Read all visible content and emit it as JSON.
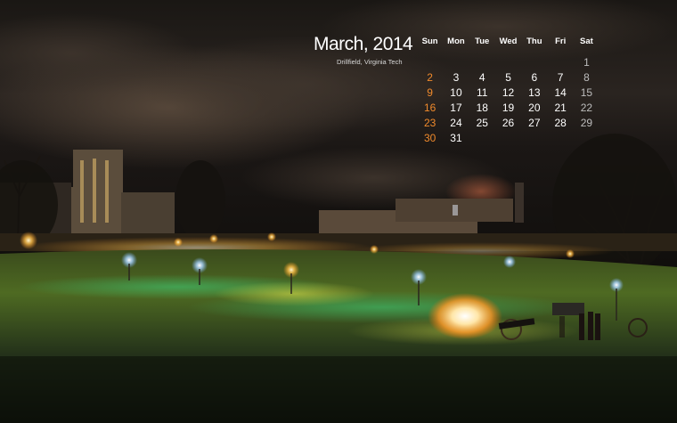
{
  "calendar": {
    "month_title": "March, 2014",
    "location": "Drillfield, Virginia Tech",
    "weekdays": [
      "Sun",
      "Mon",
      "Tue",
      "Wed",
      "Thu",
      "Fri",
      "Sat"
    ],
    "weeks": [
      [
        "",
        "",
        "",
        "",
        "",
        "",
        "1"
      ],
      [
        "2",
        "3",
        "4",
        "5",
        "6",
        "7",
        "8"
      ],
      [
        "9",
        "10",
        "11",
        "12",
        "13",
        "14",
        "15"
      ],
      [
        "16",
        "17",
        "18",
        "19",
        "20",
        "21",
        "22"
      ],
      [
        "23",
        "24",
        "25",
        "26",
        "27",
        "28",
        "29"
      ],
      [
        "30",
        "31",
        "",
        "",
        "",
        "",
        ""
      ]
    ]
  },
  "colors": {
    "sunday": "#f08a2c",
    "saturday": "#bdbdbd",
    "weekday": "#ffffff"
  }
}
